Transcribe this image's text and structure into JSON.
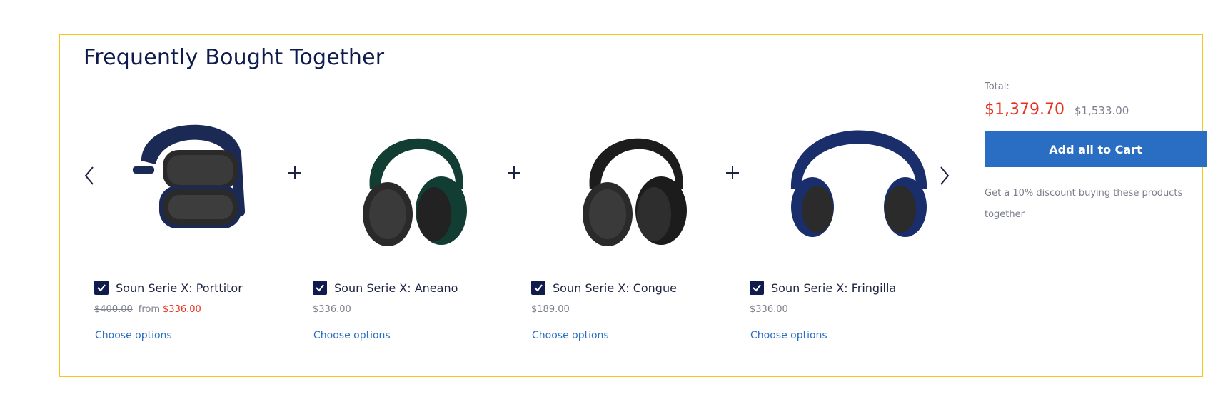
{
  "section": {
    "title": "Frequently Bought Together"
  },
  "colors": {
    "border": "#f5c518",
    "navy": "#0f1b4c",
    "sale": "#e8321f",
    "button": "#2a6ec4",
    "muted": "#7b7f8c"
  },
  "navigation": {
    "prev_icon": "chevron-left-icon",
    "next_icon": "chevron-right-icon",
    "separator_icon": "plus-icon"
  },
  "products": [
    {
      "name": "Soun Serie X: Porttitor",
      "checked": true,
      "old_price": "$400.00",
      "from_label": "from",
      "price": "$336.00",
      "link_label": "Choose options",
      "image": "headphones-navy-folded",
      "color": "#1b2a55"
    },
    {
      "name": "Soun Serie X: Aneano",
      "checked": true,
      "price": "$336.00",
      "link_label": "Choose options",
      "image": "headphones-green",
      "color": "#123d33"
    },
    {
      "name": "Soun Serie X: Congue",
      "checked": true,
      "price": "$189.00",
      "link_label": "Choose options",
      "image": "headphones-black",
      "color": "#1c1c1c"
    },
    {
      "name": "Soun Serie X: Fringilla",
      "checked": true,
      "price": "$336.00",
      "link_label": "Choose options",
      "image": "headphones-blue",
      "color": "#1a2e6b"
    }
  ],
  "summary": {
    "total_label": "Total:",
    "total_price": "$1,379.70",
    "total_old_price": "$1,533.00",
    "button_label": "Add all to Cart",
    "discount_text": "Get a 10% discount buying these products together"
  }
}
